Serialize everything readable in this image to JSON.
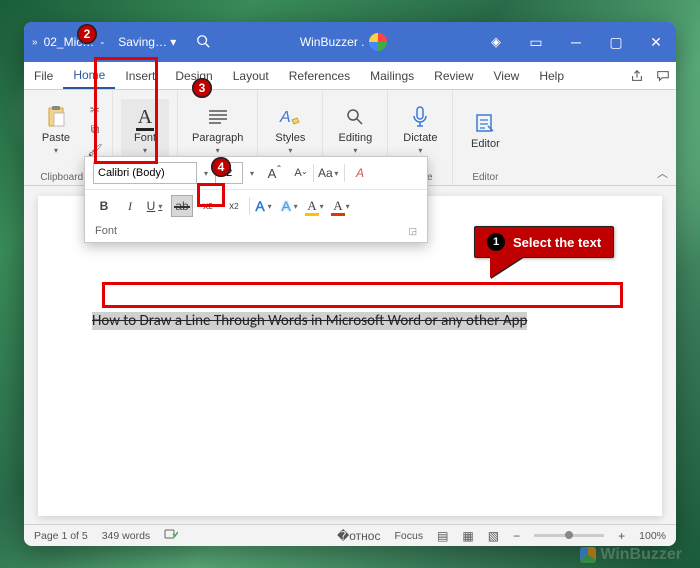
{
  "titlebar": {
    "doc": "02_Mic…",
    "saving": "Saving… ▾",
    "appname": "WinBuzzer ."
  },
  "tabs": [
    "File",
    "Home",
    "Insert",
    "Design",
    "Layout",
    "References",
    "Mailings",
    "Review",
    "View",
    "Help"
  ],
  "ribbon": {
    "clipboard": {
      "paste": "Paste",
      "label": "Clipboard"
    },
    "font": {
      "label": "Font",
      "btn": "Font"
    },
    "paragraph": {
      "label": "Paragraph",
      "btn": "Paragraph"
    },
    "styles": {
      "label": "Styles",
      "btn": "Styles"
    },
    "editing": {
      "btn": "Editing"
    },
    "voice": {
      "label": "Voice",
      "btn": "Dictate"
    },
    "editor": {
      "label": "Editor",
      "btn": "Editor"
    }
  },
  "popup": {
    "fontname": "Calibri (Body)",
    "fontsize": "12",
    "grow": "A",
    "shrink": "A",
    "changecase": "Aa",
    "clearfmt": "A",
    "bold": "B",
    "italic": "I",
    "underline": "U",
    "strike": "ab",
    "subscript": "x",
    "subscript_sub": "2",
    "superscript": "x",
    "superscript_sup": "2",
    "texteffects": "A",
    "highlight": "A",
    "fontcolor": "A",
    "label": "Font"
  },
  "document": {
    "text": "How to Draw a Line Through Words in Microsoft Word or any other App"
  },
  "statusbar": {
    "page": "Page 1 of 5",
    "words": "349 words",
    "focus": "Focus",
    "zoom": "100%"
  },
  "annot": {
    "b2": "2",
    "b3": "3",
    "b4": "4",
    "callout_num": "1",
    "callout_text": "Select the text"
  },
  "watermark": "WinBuzzer"
}
